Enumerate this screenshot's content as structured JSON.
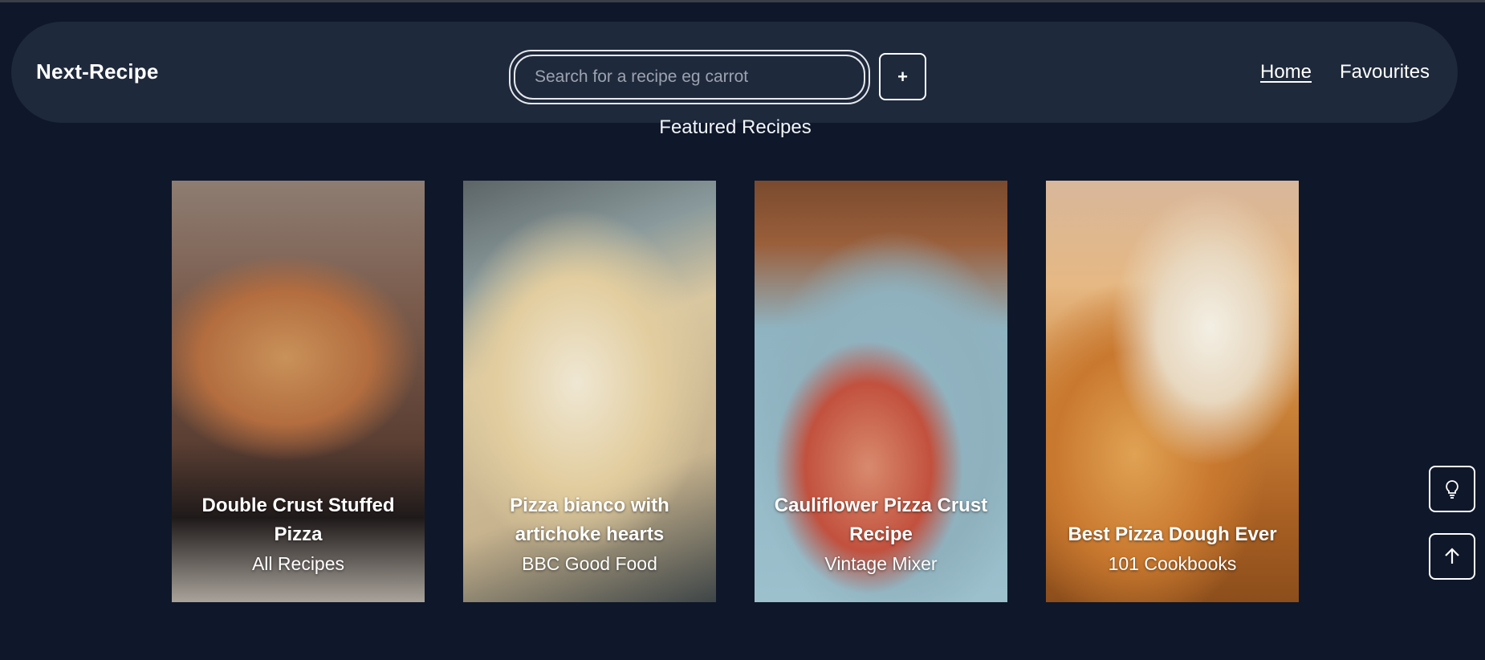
{
  "header": {
    "brand": "Next-Recipe",
    "search": {
      "placeholder": "Search for a recipe eg carrot",
      "value": ""
    },
    "add_label": "+",
    "nav": [
      {
        "label": "Home",
        "active": true
      },
      {
        "label": "Favourites",
        "active": false
      }
    ]
  },
  "main": {
    "section_title": "Featured Recipes",
    "cards": [
      {
        "title": "Double Crust Stuffed Pizza",
        "source": "All Recipes"
      },
      {
        "title": "Pizza bianco with artichoke hearts",
        "source": "BBC Good Food"
      },
      {
        "title": "Cauliflower Pizza Crust Recipe",
        "source": "Vintage Mixer"
      },
      {
        "title": "Best Pizza Dough Ever",
        "source": "101 Cookbooks"
      }
    ]
  },
  "floating": {
    "tips_icon": "lightbulb-icon",
    "top_icon": "arrow-up-icon"
  },
  "colors": {
    "background": "#0f172a",
    "navbar": "#1e293b",
    "text": "#ffffff"
  }
}
